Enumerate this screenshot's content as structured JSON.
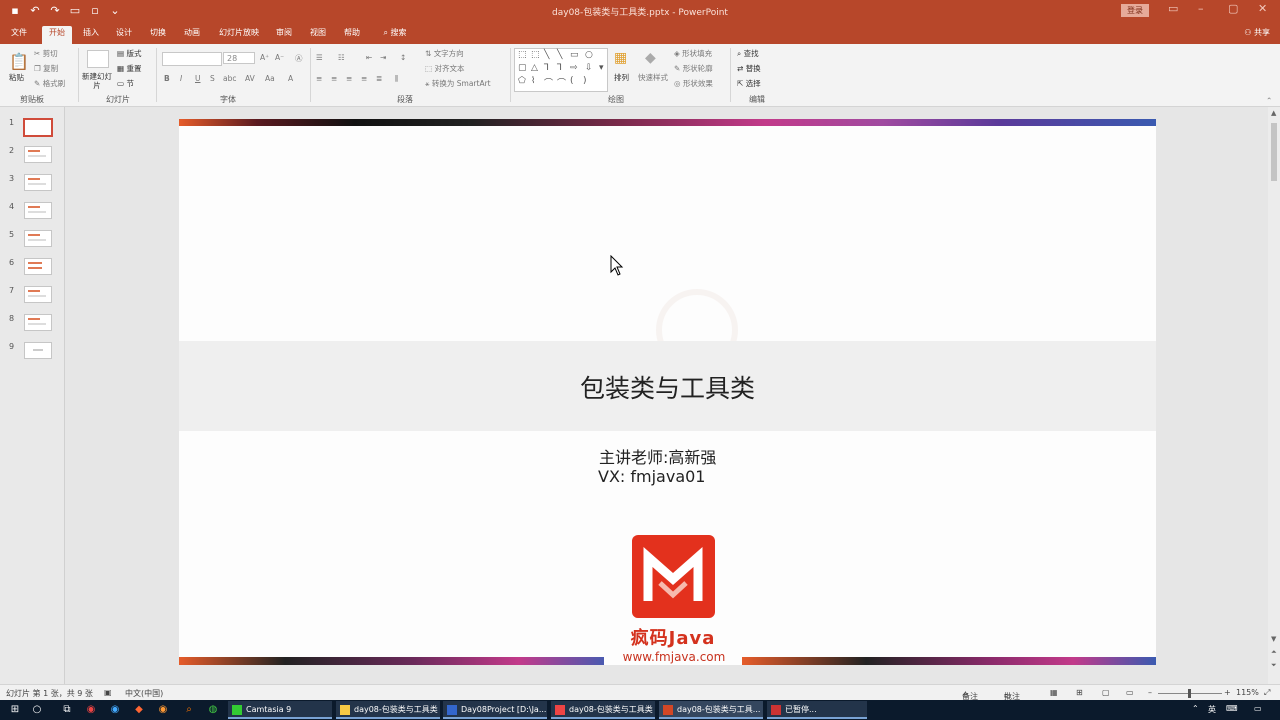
{
  "window": {
    "title": "day08-包装类与工具类.pptx  -  PowerPoint",
    "login_label": "登录"
  },
  "tabs": [
    "文件",
    "开始",
    "插入",
    "设计",
    "切换",
    "动画",
    "幻灯片放映",
    "审阅",
    "视图",
    "帮助",
    "搜索"
  ],
  "share_label": "共享",
  "ribbon": {
    "clipboard": {
      "paste": "粘贴",
      "cut": "剪切",
      "copy": "复制",
      "format_painter": "格式刷",
      "group": "剪贴板"
    },
    "slides": {
      "new_slide": "新建幻灯片",
      "layout": "版式",
      "reset": "重置",
      "section": "节",
      "group": "幻灯片"
    },
    "font": {
      "font_size": "28",
      "group": "字体"
    },
    "paragraph": {
      "text_direction": "文字方向",
      "align_text": "对齐文本",
      "smartart": "转换为 SmartArt",
      "group": "段落"
    },
    "drawing": {
      "arrange": "排列",
      "quick_styles": "快速样式",
      "shape_fill": "形状填充",
      "shape_outline": "形状轮廓",
      "shape_effects": "形状效果",
      "group": "绘图"
    },
    "editing": {
      "find": "查找",
      "replace": "替换",
      "select": "选择",
      "group": "编辑"
    }
  },
  "thumbnails": [
    "1",
    "2",
    "3",
    "4",
    "5",
    "6",
    "7",
    "8",
    "9"
  ],
  "slide": {
    "title": "包装类与工具类",
    "teacher": "主讲老师:高新强",
    "vx": "VX:  fmjava01",
    "brand": "疯码Java",
    "url": "www.fmjava.com"
  },
  "statusbar": {
    "slide_info": "幻灯片 第 1 张，共 9 张",
    "language": "中文(中国)",
    "notes": "备注",
    "comments": "批注",
    "zoom": "115%"
  },
  "taskbar": {
    "tasks": [
      "Camtasia 9",
      "day08-包装类与工具类",
      "Day08Project [D:\\Ja...",
      "day08-包装类与工具类",
      "day08-包装类与工具...",
      "已暂停..."
    ],
    "ime": "英"
  },
  "colors": {
    "accent": "#b7472a",
    "brand_red": "#e3311d"
  }
}
